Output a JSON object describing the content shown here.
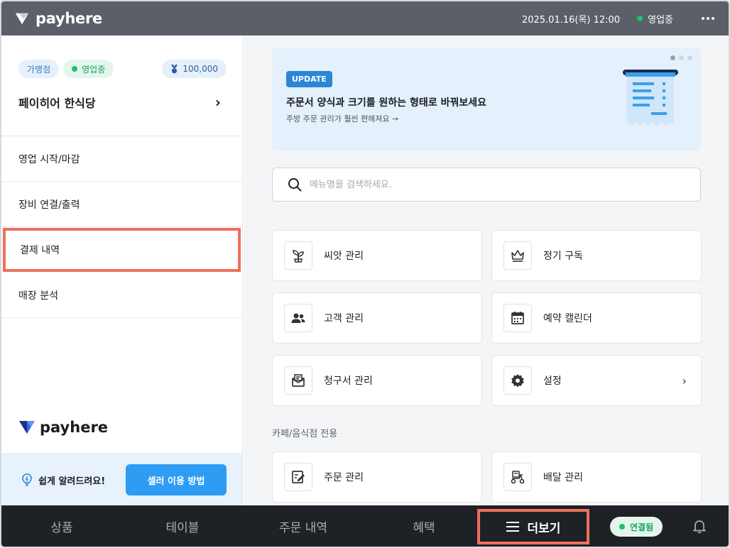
{
  "topbar": {
    "brand": "payhere",
    "datetime": "2025.01.16(목) 12:00",
    "status": "영업중"
  },
  "sidebar": {
    "chip_store_type": "가맹점",
    "chip_status": "영업중",
    "points": "100,000",
    "store_name": "페이히어 한식당",
    "items": [
      {
        "label": "영업 시작/마감"
      },
      {
        "label": "장비 연결/출력"
      },
      {
        "label": "결제 내역"
      },
      {
        "label": "매장 분석"
      }
    ],
    "brand": "payhere",
    "help_text": "쉽게 알려드려요!",
    "help_button": "셀러 이용 방법"
  },
  "banner": {
    "badge": "UPDATE",
    "title": "주문서 양식과 크기를 원하는 형태로 바꿔보세요",
    "subtitle": "주방 주문 관리가 훨씬 편해져요 →"
  },
  "search": {
    "placeholder": "메뉴명을 검색하세요."
  },
  "cards": [
    {
      "label": "씨앗 관리",
      "icon": "sprout-icon"
    },
    {
      "label": "정기 구독",
      "icon": "crown-icon"
    },
    {
      "label": "고객 관리",
      "icon": "people-icon"
    },
    {
      "label": "예약 캘린더",
      "icon": "calendar-icon"
    },
    {
      "label": "청구서 관리",
      "icon": "invoice-icon"
    },
    {
      "label": "설정",
      "icon": "gear-icon"
    }
  ],
  "section_label": "카페/음식점 전용",
  "cafe_cards": [
    {
      "label": "주문 관리",
      "icon": "order-edit-icon"
    },
    {
      "label": "배달 관리",
      "icon": "delivery-scooter-icon"
    }
  ],
  "bottombar": {
    "tabs": [
      {
        "label": "상품"
      },
      {
        "label": "테이블"
      },
      {
        "label": "주문 내역"
      },
      {
        "label": "혜택"
      }
    ],
    "more_label": "더보기",
    "connection": "연결됨"
  }
}
